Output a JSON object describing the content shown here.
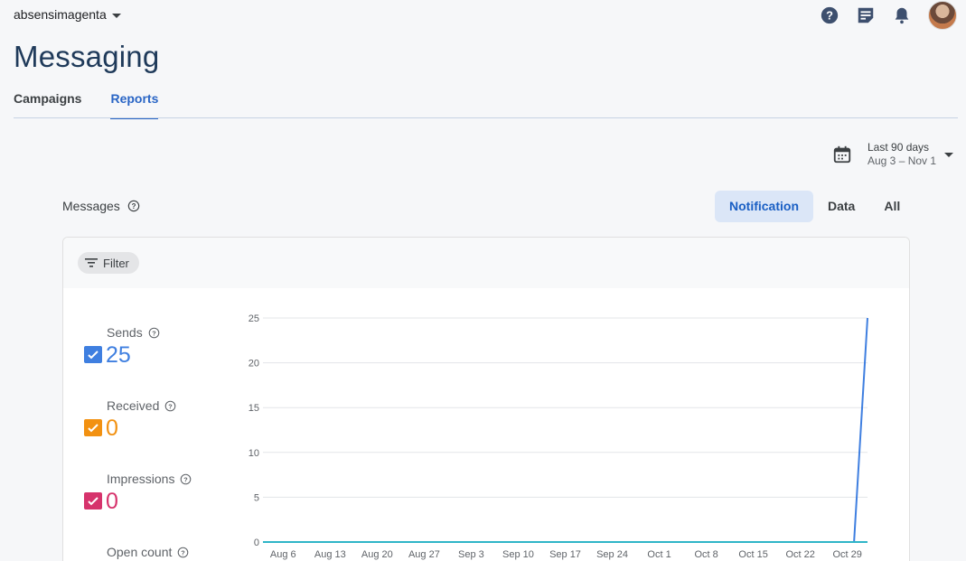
{
  "header": {
    "project_name": "absensimagenta",
    "icons": [
      "help-icon",
      "feedback-icon",
      "notifications-icon",
      "avatar"
    ]
  },
  "page_title": "Messaging",
  "tabs": [
    {
      "label": "Campaigns",
      "active": false
    },
    {
      "label": "Reports",
      "active": true
    }
  ],
  "date_range": {
    "label": "Last 90 days",
    "range": "Aug 3 – Nov 1"
  },
  "section": {
    "label": "Messages"
  },
  "toggles": [
    {
      "label": "Notification",
      "active": true
    },
    {
      "label": "Data",
      "active": false
    },
    {
      "label": "All",
      "active": false
    }
  ],
  "filter": {
    "label": "Filter"
  },
  "metrics": [
    {
      "label": "Sends",
      "value": "25",
      "color": "#3f7fe0"
    },
    {
      "label": "Received",
      "value": "0",
      "color": "#f29111"
    },
    {
      "label": "Impressions",
      "value": "0",
      "color": "#d6336c"
    },
    {
      "label": "Open count",
      "value": "",
      "color": "#3f7fe0"
    }
  ],
  "chart_data": {
    "type": "line",
    "x": [
      "Aug 6",
      "Aug 13",
      "Aug 20",
      "Aug 27",
      "Sep 3",
      "Sep 10",
      "Sep 17",
      "Sep 24",
      "Oct 1",
      "Oct 8",
      "Oct 15",
      "Oct 22",
      "Oct 29"
    ],
    "yticks": [
      0,
      5,
      10,
      15,
      20,
      25
    ],
    "ylim": [
      0,
      25
    ],
    "grid": true,
    "series": [
      {
        "name": "Sends",
        "color": "#3f7fe0",
        "points": [
          {
            "x": "Aug 3",
            "y": 0
          },
          {
            "x": "Oct 30",
            "y": 0
          },
          {
            "x": "Nov 1",
            "y": 25
          }
        ]
      },
      {
        "name": "Received",
        "color": "#2fb5c7",
        "points": [
          {
            "x": "Aug 3",
            "y": 0
          },
          {
            "x": "Nov 1",
            "y": 0
          }
        ]
      }
    ]
  }
}
